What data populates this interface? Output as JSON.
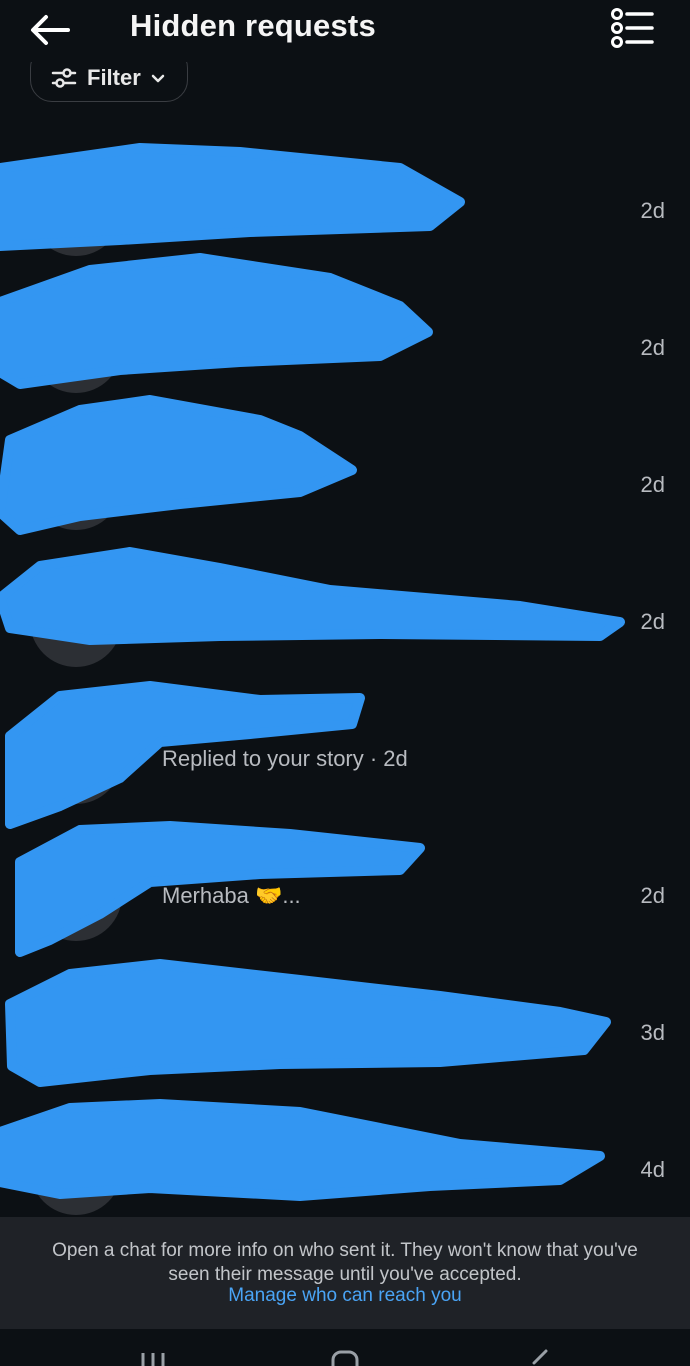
{
  "header": {
    "title": "Hidden requests",
    "back_icon": "arrow-left-icon",
    "list_icon": "list-options-icon"
  },
  "filter": {
    "label": "Filter",
    "icon": "sliders-icon",
    "chevron_icon": "chevron-down-icon"
  },
  "requests": [
    {
      "name": "",
      "preview": "",
      "time": "2d"
    },
    {
      "name": "",
      "preview": "",
      "time": "2d"
    },
    {
      "name": "",
      "preview": "",
      "time": "2d"
    },
    {
      "name": "",
      "preview": "",
      "time": "2d"
    },
    {
      "name": "",
      "preview": "Replied to your story · 2d",
      "time": ""
    },
    {
      "name": "",
      "preview": "Merhaba 🤝...",
      "time": "2d"
    },
    {
      "name": "",
      "preview": "",
      "time": "3d"
    },
    {
      "name": "",
      "preview": "",
      "time": "4d"
    }
  ],
  "footer": {
    "info": "Open a chat for more info on who sent it. They won't know that you've seen their message until you've accepted.",
    "link": "Manage who can reach you"
  },
  "nav": {
    "recent_icon": "recent-apps-icon",
    "home_icon": "home-icon",
    "back_icon": "back-chevron-icon"
  },
  "colors": {
    "background": "#0c1014",
    "footer_background": "#1f2227",
    "link": "#4aa4f5",
    "redaction": "#3396f2"
  }
}
